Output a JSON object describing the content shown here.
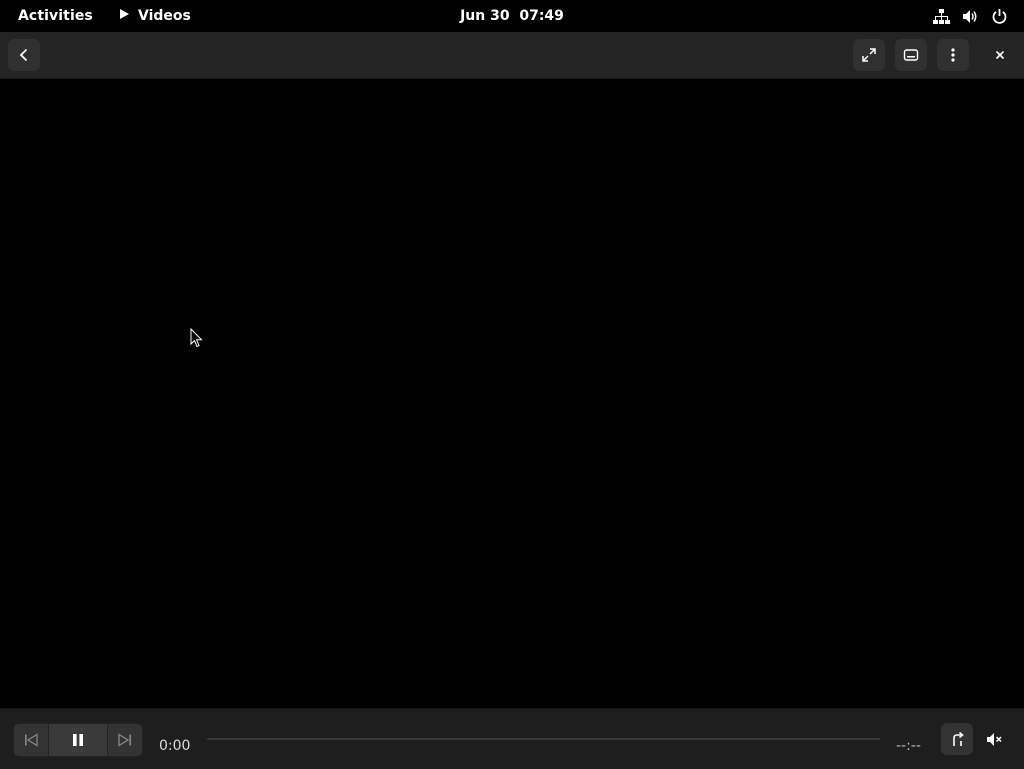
{
  "top_panel": {
    "activities_label": "Activities",
    "app_name": "Videos",
    "clock": "Jun 30  07:49",
    "tray_icons": [
      "network-icon",
      "volume-icon",
      "power-icon"
    ]
  },
  "headerbar": {
    "buttons": [
      "back-icon",
      "fullscreen-icon",
      "subtitles-icon",
      "more-icon",
      "close-icon"
    ]
  },
  "player": {
    "current_time": "0:00",
    "total_time": "--:--",
    "progress": 0,
    "controls": [
      "previous-icon",
      "pause-icon",
      "next-icon",
      "repeat-icon",
      "volume-muted-icon"
    ]
  },
  "colors": {
    "panel_bg": "#000000",
    "headerbar_bg": "#242424",
    "controls_bg": "#1e1e1e",
    "video_bg": "#000000"
  }
}
